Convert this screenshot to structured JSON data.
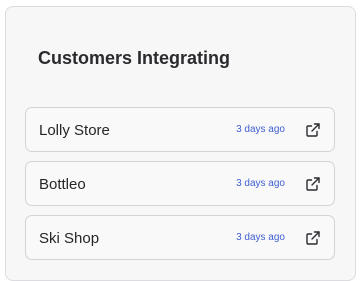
{
  "panel": {
    "title": "Customers Integrating"
  },
  "customers": [
    {
      "name": "Lolly Store",
      "time": "3 days ago",
      "icon": "external-link-icon"
    },
    {
      "name": "Bottleo",
      "time": "3 days ago",
      "icon": "external-link-icon"
    },
    {
      "name": "Ski Shop",
      "time": "3 days ago",
      "icon": "external-link-icon"
    }
  ],
  "colors": {
    "accent": "#3f5ed0",
    "panel_bg": "#f7f7f8",
    "border": "#d4d4d8",
    "text": "#262629"
  }
}
